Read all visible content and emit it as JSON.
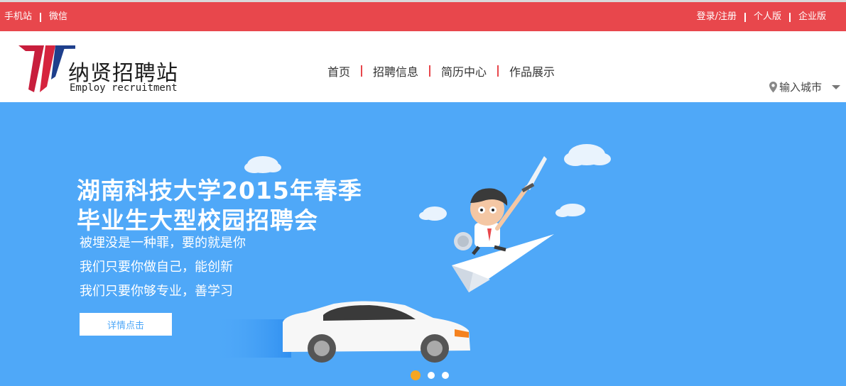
{
  "topbar": {
    "left_links": [
      "手机站",
      "微信"
    ],
    "right_links": [
      "登录/注册",
      "个人版",
      "企业版"
    ],
    "bg_color": "#e8474c"
  },
  "logo": {
    "cn": "纳贤招聘站",
    "en": "Employ recruitment"
  },
  "nav": {
    "items": [
      "首页",
      "招聘信息",
      "简历中心",
      "作品展示"
    ],
    "separator_color": "#e8474c"
  },
  "city": {
    "label": "输入城市",
    "icon": "location-pin-icon",
    "caret_icon": "caret-down-icon"
  },
  "banner": {
    "title_line1": "湖南科技大学2015年春季",
    "title_line2": "毕业生大型校园招聘会",
    "lines": [
      "被埋没是一种罪，要的就是你",
      "我们只要你做自己，能创新",
      "我们只要你够专业，善学习"
    ],
    "button": "详情点击",
    "bg_color": "#4fa8f8",
    "slide_count": 3,
    "active_slide": 1
  }
}
